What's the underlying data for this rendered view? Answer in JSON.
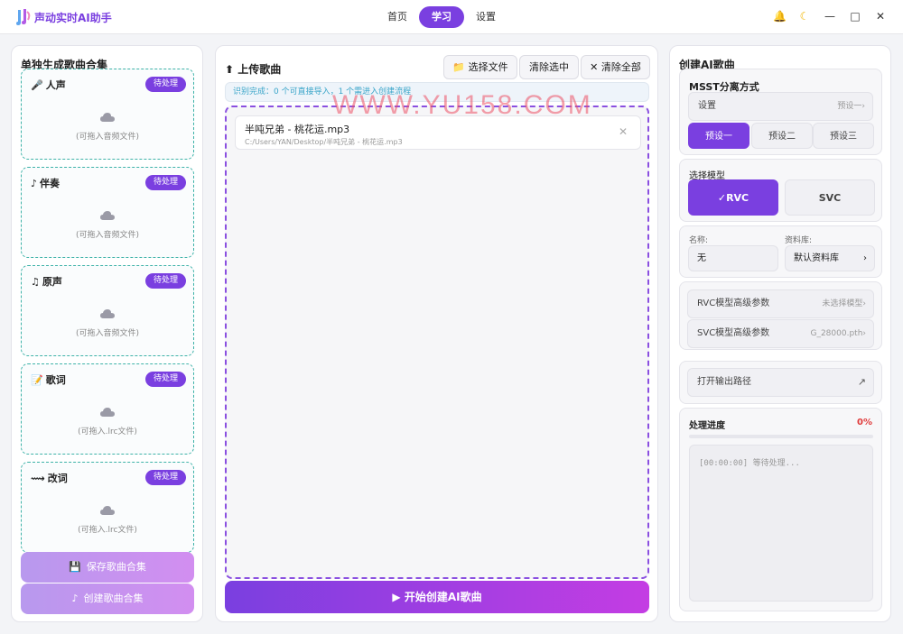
{
  "app": {
    "title": "声动实时AI助手"
  },
  "nav": {
    "tabs": [
      "首页",
      "学习",
      "设置"
    ],
    "active": 1
  },
  "window": {
    "icons": [
      "bell-icon",
      "moon-icon",
      "minimize-icon",
      "maximize-icon",
      "close-icon"
    ]
  },
  "left": {
    "title": "单独生成歌曲合集",
    "tracks": [
      {
        "icon": "🎤",
        "label": "人声",
        "badge": "待处理",
        "hint": "(可拖入音频文件)"
      },
      {
        "icon": "♪",
        "label": "伴奏",
        "badge": "待处理",
        "hint": "(可拖入音频文件)"
      },
      {
        "icon": "♫",
        "label": "原声",
        "badge": "待处理",
        "hint": "(可拖入音频文件)"
      },
      {
        "icon": "📝",
        "label": "歌词",
        "badge": "待处理",
        "hint": "(可拖入.lrc文件)"
      },
      {
        "icon": "⟿",
        "label": "改词",
        "badge": "待处理",
        "hint": "(可拖入.lrc文件)"
      }
    ],
    "save_button": "保存歌曲合集",
    "create_button": "创建歌曲合集"
  },
  "middle": {
    "title": "上传歌曲",
    "title_icon": "⬆",
    "select_file": "选择文件",
    "clear_selected": "清除选中",
    "clear_all": "清除全部",
    "info": "识别完成：0 个可直接导入，1 个需进入创建流程",
    "file": {
      "name": "半吨兄弟 - 桃花运.mp3",
      "path": "C:/Users/YAN/Desktop/半吨兄弟 - 桃花运.mp3"
    },
    "start_button": "开始创建AI歌曲",
    "start_icon": "▶"
  },
  "right": {
    "title": "创建AI歌曲",
    "msst": {
      "title": "MSST分离方式",
      "settings_label": "设置",
      "settings_hint": "预设一›",
      "presets": [
        "预设一",
        "预设二",
        "预设三"
      ],
      "active_preset": 0
    },
    "model": {
      "title": "选择模型",
      "options": [
        "✓RVC",
        "SVC"
      ],
      "active": 0
    },
    "name_field": {
      "label": "名称:",
      "value": "无"
    },
    "library_field": {
      "label": "资料库:",
      "value": "默认资料库",
      "arrow": "›"
    },
    "rvc_params": {
      "label": "RVC模型高级参数",
      "hint": "未选择模型›"
    },
    "svc_params": {
      "label": "SVC模型高级参数",
      "hint": "G_28000.pth›"
    },
    "open_output": {
      "label": "打开输出路径",
      "arrow": "↗"
    },
    "progress": {
      "title": "处理进度",
      "percent_label": "0%",
      "value": 0,
      "log": "[00:00:00] 等待处理..."
    }
  },
  "watermark": "WWW.YU158.COM",
  "colors": {
    "accent": "#7a3fe0",
    "accent2": "#c43de3",
    "teal": "#3db2a8",
    "danger": "#e03b3b"
  }
}
